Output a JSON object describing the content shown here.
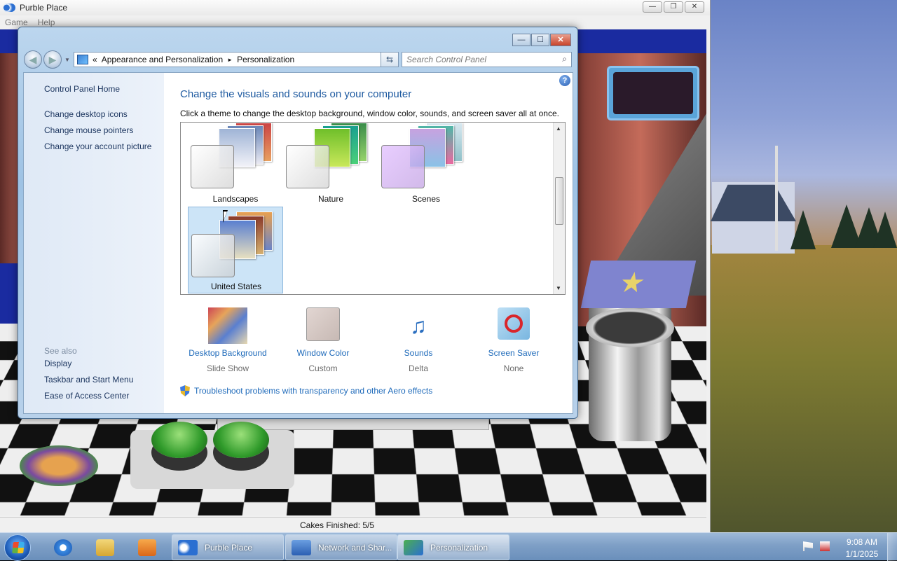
{
  "purble": {
    "title": "Purble Place",
    "menu": [
      "Game",
      "Help"
    ],
    "status": "Cakes Finished: 5/5"
  },
  "personalization": {
    "breadcrumb": {
      "overflow": "«",
      "parent": "Appearance and Personalization",
      "separator": "►",
      "current": "Personalization"
    },
    "search_placeholder": "Search Control Panel",
    "sidebar": {
      "home": "Control Panel Home",
      "links": [
        "Change desktop icons",
        "Change mouse pointers",
        "Change your account picture"
      ],
      "see_also_label": "See also",
      "see_also": [
        "Display",
        "Taskbar and Start Menu",
        "Ease of Access Center"
      ]
    },
    "heading": "Change the visuals and sounds on your computer",
    "subheading": "Click a theme to change the desktop background, window color, sounds, and screen saver all at once.",
    "themes": [
      "Landscapes",
      "Nature",
      "Scenes",
      "United States"
    ],
    "selected_theme": "United States",
    "options": [
      {
        "label": "Desktop Background",
        "value": "Slide Show",
        "icon": "desktop-background-icon"
      },
      {
        "label": "Window Color",
        "value": "Custom",
        "icon": "window-color-icon"
      },
      {
        "label": "Sounds",
        "value": "Delta",
        "icon": "sounds-icon"
      },
      {
        "label": "Screen Saver",
        "value": "None",
        "icon": "screen-saver-icon"
      }
    ],
    "troubleshoot": "Troubleshoot problems with transparency and other Aero effects"
  },
  "taskbar": {
    "pinned": [
      "internet-explorer-icon",
      "windows-explorer-icon",
      "media-player-icon"
    ],
    "tasks": [
      {
        "label": "Purble Place",
        "active": false
      },
      {
        "label": "Network and Shar...",
        "active": false
      },
      {
        "label": "Personalization",
        "active": true
      }
    ],
    "time": "9:08 AM",
    "date": "1/1/2025"
  },
  "colors": {
    "link": "#1e6aba",
    "heading": "#1e5aa0",
    "selected_theme_bg": "#cce4f7"
  }
}
